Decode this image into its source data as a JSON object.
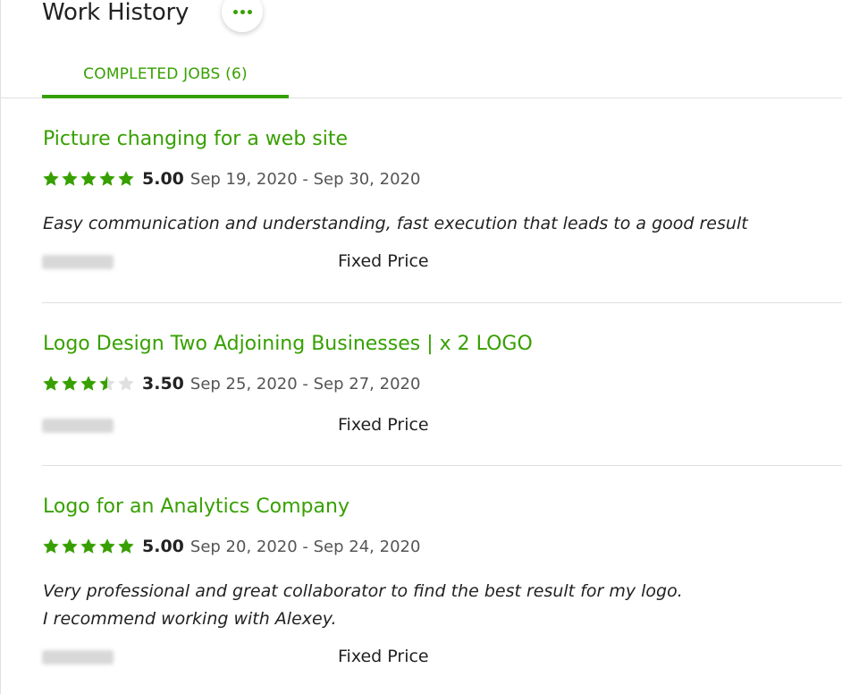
{
  "header": {
    "title": "Work History",
    "more_icon": "ellipsis-icon"
  },
  "tabs": [
    {
      "label": "COMPLETED JOBS (6)",
      "active": true
    }
  ],
  "colors": {
    "accent": "#37a000",
    "star_empty": "#e0e0e0"
  },
  "jobs": [
    {
      "title": "Picture changing for a web site",
      "rating": 5,
      "score": "5.00",
      "dates": "Sep 19, 2020 - Sep 30, 2020",
      "feedback": [
        "Easy communication and understanding, fast execution that leads to a good result"
      ],
      "price_type": "Fixed Price"
    },
    {
      "title": "Logo Design Two Adjoining Businesses | x 2 LOGO",
      "rating": 3.5,
      "score": "3.50",
      "dates": "Sep 25, 2020 - Sep 27, 2020",
      "feedback": [],
      "price_type": "Fixed Price"
    },
    {
      "title": "Logo for an Analytics Company",
      "rating": 5,
      "score": "5.00",
      "dates": "Sep 20, 2020 - Sep 24, 2020",
      "feedback": [
        "Very professional and great collaborator to find the best result for my logo.",
        "I recommend working with Alexey."
      ],
      "price_type": "Fixed Price"
    }
  ]
}
